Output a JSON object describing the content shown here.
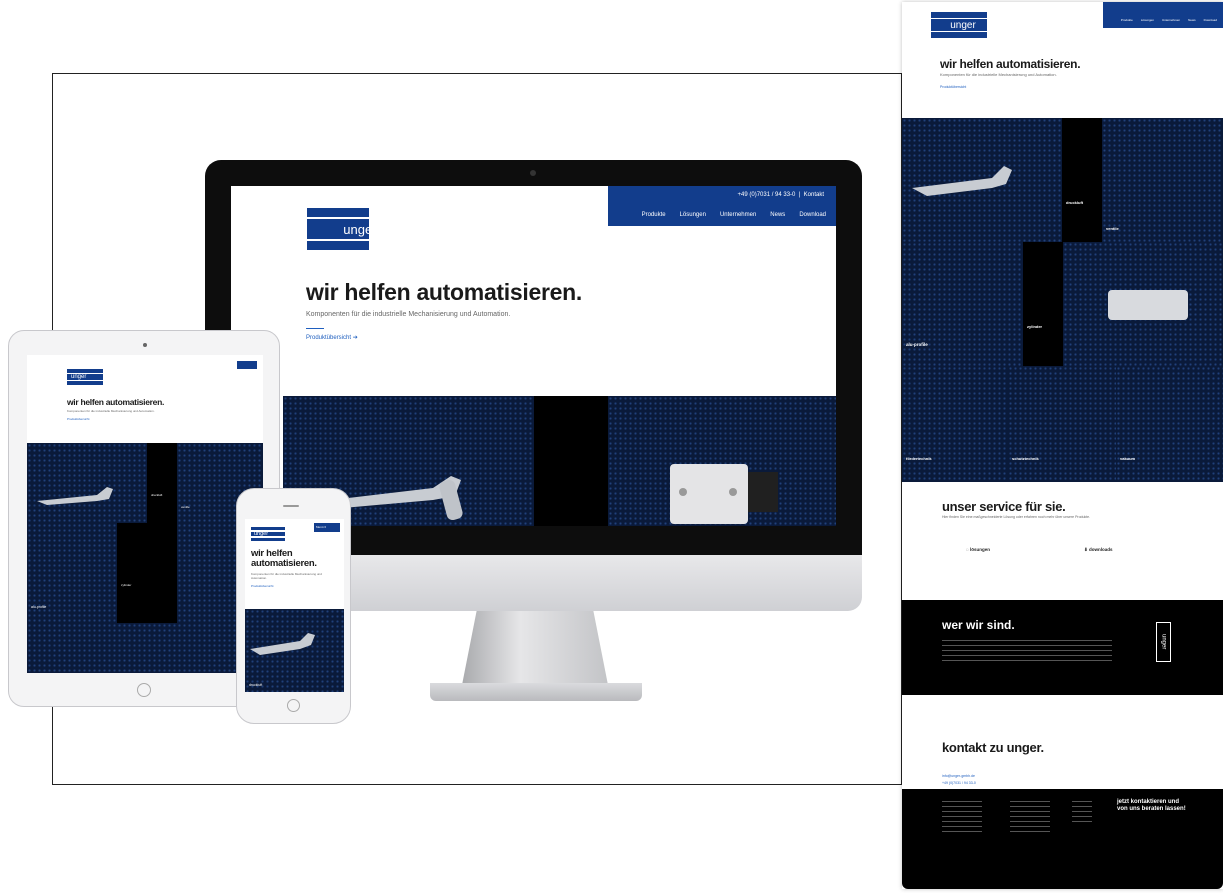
{
  "brand": {
    "logo_text": "unger",
    "blue": "#123d8c",
    "link_blue": "#1f5fbf"
  },
  "desktop": {
    "phone": "+49 (0)7031 / 94 33-0",
    "contact": "Kontakt",
    "nav": [
      "Produkte",
      "Lösungen",
      "Unternehmen",
      "News",
      "Download"
    ],
    "headline": "wir helfen automatisieren.",
    "subline": "Komponenten für die industrielle Mechanisierung und Automation.",
    "link": "Produktübersicht"
  },
  "tablet": {
    "headline": "wir helfen automatisieren.",
    "subline": "Komponenten für die industrielle Mechanisierung und Automation.",
    "link": "Produktübersicht",
    "tiles": [
      "druckluft",
      "ventile",
      "alu-profile",
      "zylinder"
    ]
  },
  "phone": {
    "menu": "Menü",
    "headline": "wir helfen automatisieren.",
    "subline": "Komponenten für die industrielle Mechanisierung und Automation.",
    "link": "Produktübersicht",
    "tile": "druckluft"
  },
  "fullpage": {
    "headline": "wir helfen automatisieren.",
    "subline": "Komponenten für die industrielle Mechanisierung und Automation.",
    "link": "Produktübersicht",
    "nav": [
      "Produkte",
      "Lösungen",
      "Unternehmen",
      "News",
      "Download"
    ],
    "tiles": [
      "druckluft",
      "ventile",
      "alu-profile",
      "zylinder",
      "fördertechnik",
      "schutztechnik",
      "vakuum"
    ],
    "service_heading": "unser service für sie.",
    "service_sub": "Hier finden Sie eine maßgeschneiderte Lösung oder erfahren noch mehr über unsere Produkte.",
    "service_items": [
      "lösungen",
      "downloads"
    ],
    "who_heading": "wer wir sind.",
    "contact_heading": "kontakt zu unger.",
    "contact_email": "info@unger-gmbh.de",
    "contact_phone": "+49 (0)7031 / 94 33-0",
    "footer_cta": "jetzt kontaktieren und von uns beraten lassen!"
  }
}
